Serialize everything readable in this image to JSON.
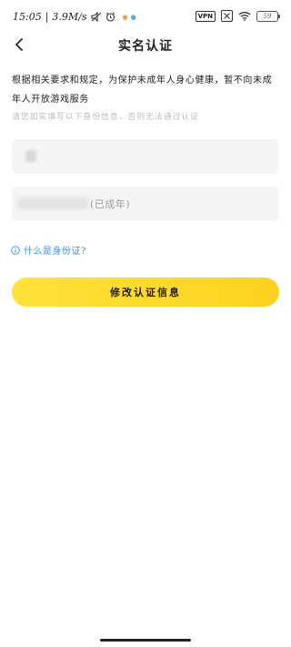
{
  "status_bar": {
    "time": "15:05",
    "net_speed": "3.9M/s",
    "vpn_label": "VPN",
    "battery_level": "59"
  },
  "header": {
    "title": "实名认证"
  },
  "notice": {
    "text": "根据相关要求和规定，为保护未成年人身心健康，暂不向未成年人开放游戏服务",
    "hint": "请您如实填写以下身份信息，否则无法通过认证"
  },
  "form": {
    "adult_status": "(已成年)"
  },
  "help": {
    "label": "什么是身份证?"
  },
  "actions": {
    "submit_label": "修改认证信息",
    "button_color": "#fdd827"
  },
  "colors": {
    "link": "#3b8ee8",
    "hint": "#bdbdbd",
    "field_bg": "#f5f5f5"
  }
}
